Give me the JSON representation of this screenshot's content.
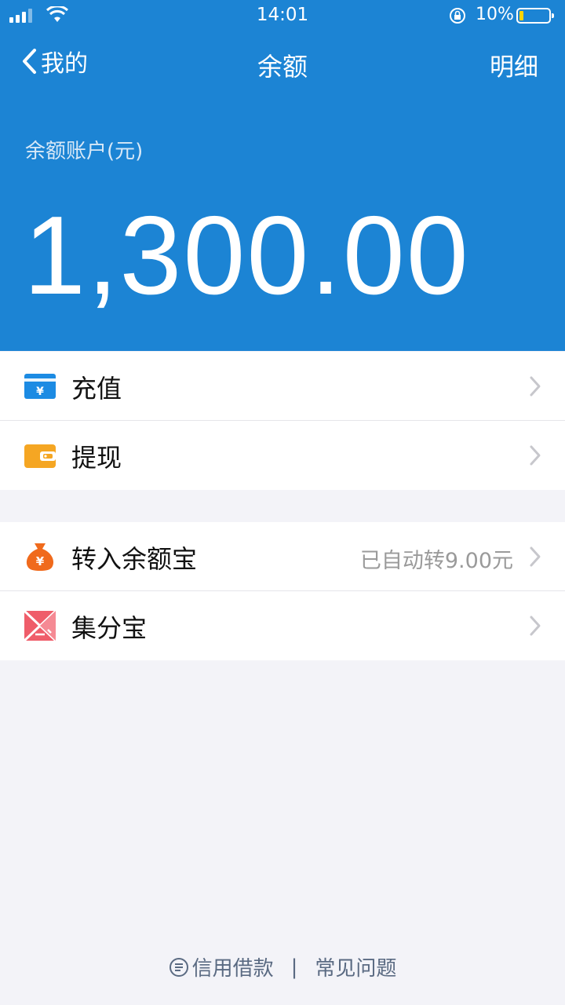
{
  "status_bar": {
    "time": "14:01",
    "battery_percent": "10%"
  },
  "nav": {
    "back_label": "我的",
    "title": "余额",
    "detail_label": "明细"
  },
  "account": {
    "label": "余额账户(元)",
    "balance": "1,300.00"
  },
  "menu_group_1": [
    {
      "icon": "card-yuan-icon",
      "label": "充值"
    },
    {
      "icon": "wallet-icon",
      "label": "提现"
    }
  ],
  "menu_group_2": [
    {
      "icon": "money-bag-icon",
      "label": "转入余额宝",
      "extra": "已自动转9.00元"
    },
    {
      "icon": "jifenbao-icon",
      "label": "集分宝"
    }
  ],
  "footer": {
    "credit_loan": "信用借款",
    "separator": "|",
    "faq": "常见问题"
  },
  "colors": {
    "header_blue": "#1c84d4",
    "page_bg": "#f3f3f8"
  }
}
